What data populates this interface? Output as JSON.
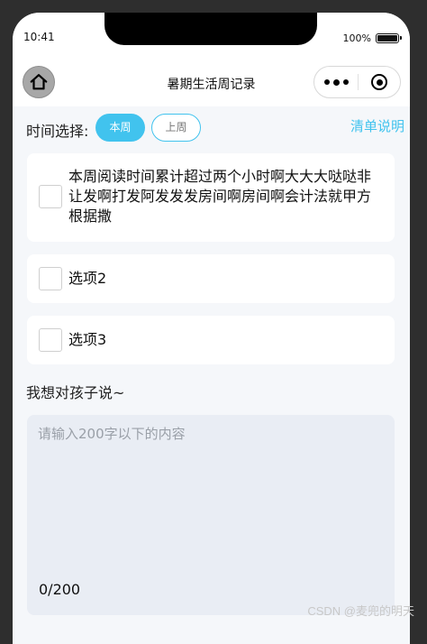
{
  "status": {
    "time": "10:41",
    "battery": "100%"
  },
  "nav": {
    "title": "暑期生活周记录"
  },
  "filter": {
    "label": "时间选择:",
    "this_week": "本周",
    "last_week": "上周",
    "list_link": "清单说明"
  },
  "options": [
    {
      "label": "本周阅读时间累计超过两个小时啊大大大哒哒非让发啊打发阿发发发房间啊房间啊会计法就甲方根据撒",
      "checked": false
    },
    {
      "label": "选项2",
      "checked": false
    },
    {
      "label": "选项3",
      "checked": false
    }
  ],
  "message": {
    "label": "我想对孩子说~",
    "placeholder": "请输入200字以下的内容",
    "value": "",
    "counter": "0/200"
  },
  "watermark": "CSDN @麦兜的明天",
  "colors": {
    "accent": "#41c3ee",
    "background": "#f5f7fa",
    "textarea_bg": "#e9edf4"
  },
  "icons": {
    "home": "home-icon",
    "more": "more-dots-icon",
    "close": "target-circle-icon"
  }
}
